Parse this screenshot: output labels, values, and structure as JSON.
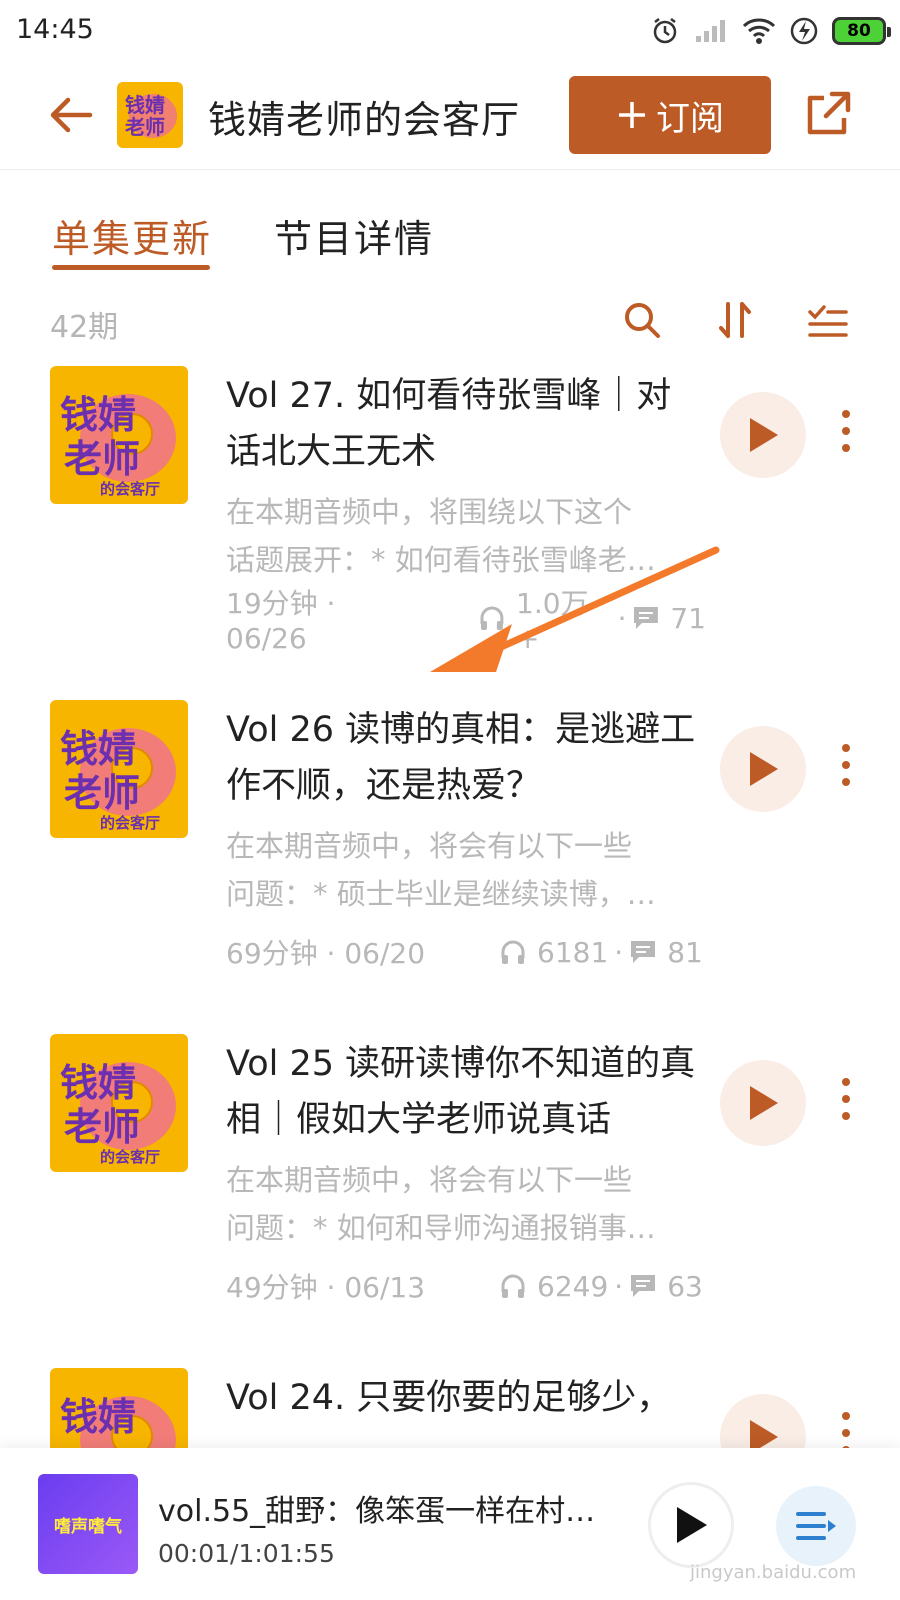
{
  "status_bar": {
    "time": "14:45",
    "battery": "80"
  },
  "header": {
    "title": "钱婧老师的会客厅",
    "subscribe_label": "订阅",
    "subscribe_icon": "plus-icon"
  },
  "tabs": [
    {
      "label": "单集更新",
      "active": true
    },
    {
      "label": "节目详情",
      "active": false
    }
  ],
  "toolbar": {
    "count": "42期"
  },
  "cover_text": {
    "line1": "钱婧",
    "line2": "老师",
    "line3": "的会客厅"
  },
  "episodes": [
    {
      "title": "Vol 27. 如何看待张雪峰｜对话北大王无术",
      "desc1": "在本期音频中，将围绕以下这个",
      "desc2": "话题展开：* 如何看待张雪峰老…",
      "meta": "19分钟 · 06/26",
      "plays": "1.0万+",
      "comments": "71"
    },
    {
      "title": "Vol 26 读博的真相：是逃避工作不顺，还是热爱？",
      "desc1": "在本期音频中，将会有以下一些",
      "desc2": "问题：* 硕士毕业是继续读博，…",
      "meta": "69分钟 · 06/20",
      "plays": "6181",
      "comments": "81"
    },
    {
      "title": "Vol 25 读研读博你不知道的真相｜假如大学老师说真话",
      "desc1": "在本期音频中，将会有以下一些",
      "desc2": "问题：* 如何和导师沟通报销事…",
      "meta": "49分钟 · 06/13",
      "plays": "6249",
      "comments": "63"
    },
    {
      "title": "Vol 24. 只要你要的足够少，",
      "desc1": "",
      "desc2": "",
      "meta": "",
      "plays": "",
      "comments": ""
    }
  ],
  "player": {
    "title": "vol.55_甜野：像笨蛋一样在村…",
    "time": "00:01/1:01:55",
    "cover_text": "嗜声嗜气"
  },
  "watermark": "jingyan.baidu.com",
  "colors": {
    "accent": "#bd5b26",
    "cover_bg": "#f7b500",
    "arrow": "#f37a2a"
  }
}
